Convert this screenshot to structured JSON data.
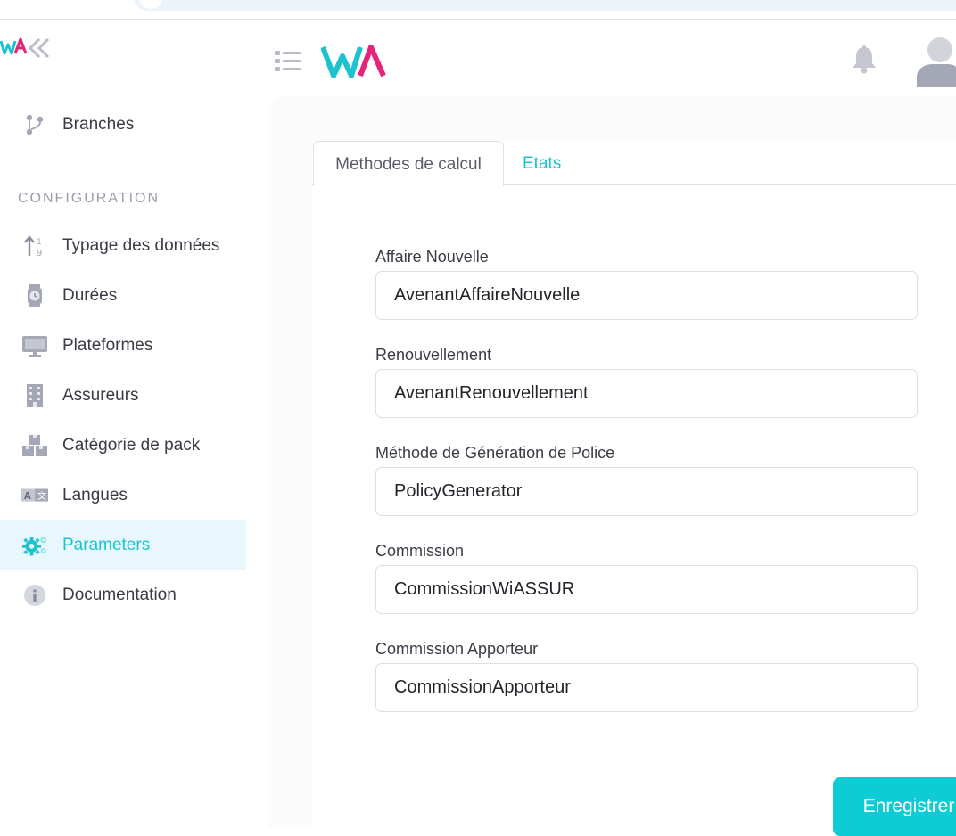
{
  "brand": {
    "colors": {
      "accent": "#1cc3cf",
      "pink": "#e6227a",
      "active_bg": "#e8f7fc",
      "button": "#0fcbd3"
    }
  },
  "sidebar": {
    "top_item": {
      "label": "Branches",
      "icon": "git-branch-icon"
    },
    "section_title": "CONFIGURATION",
    "items": [
      {
        "label": "Typage des données",
        "icon": "sort-numeric-icon",
        "active": false
      },
      {
        "label": "Durées",
        "icon": "watch-icon",
        "active": false
      },
      {
        "label": "Plateformes",
        "icon": "monitor-icon",
        "active": false
      },
      {
        "label": "Assureurs",
        "icon": "building-icon",
        "active": false
      },
      {
        "label": "Catégorie de pack",
        "icon": "boxes-icon",
        "active": false
      },
      {
        "label": "Langues",
        "icon": "language-icon",
        "active": false
      },
      {
        "label": "Parameters",
        "icon": "gears-icon",
        "active": true
      },
      {
        "label": "Documentation",
        "icon": "info-icon",
        "active": false
      }
    ]
  },
  "tabs": [
    {
      "label": "Methodes de calcul",
      "active": true
    },
    {
      "label": "Etats",
      "active": false
    }
  ],
  "form": {
    "fields": [
      {
        "label": "Affaire Nouvelle",
        "value": "AvenantAffaireNouvelle"
      },
      {
        "label": "Renouvellement",
        "value": "AvenantRenouvellement"
      },
      {
        "label": "Méthode de Génération de Police",
        "value": "PolicyGenerator"
      },
      {
        "label": "Commission",
        "value": "CommissionWiASSUR"
      },
      {
        "label": "Commission Apporteur",
        "value": "CommissionApporteur"
      }
    ],
    "submit_label": "Enregistrer"
  }
}
